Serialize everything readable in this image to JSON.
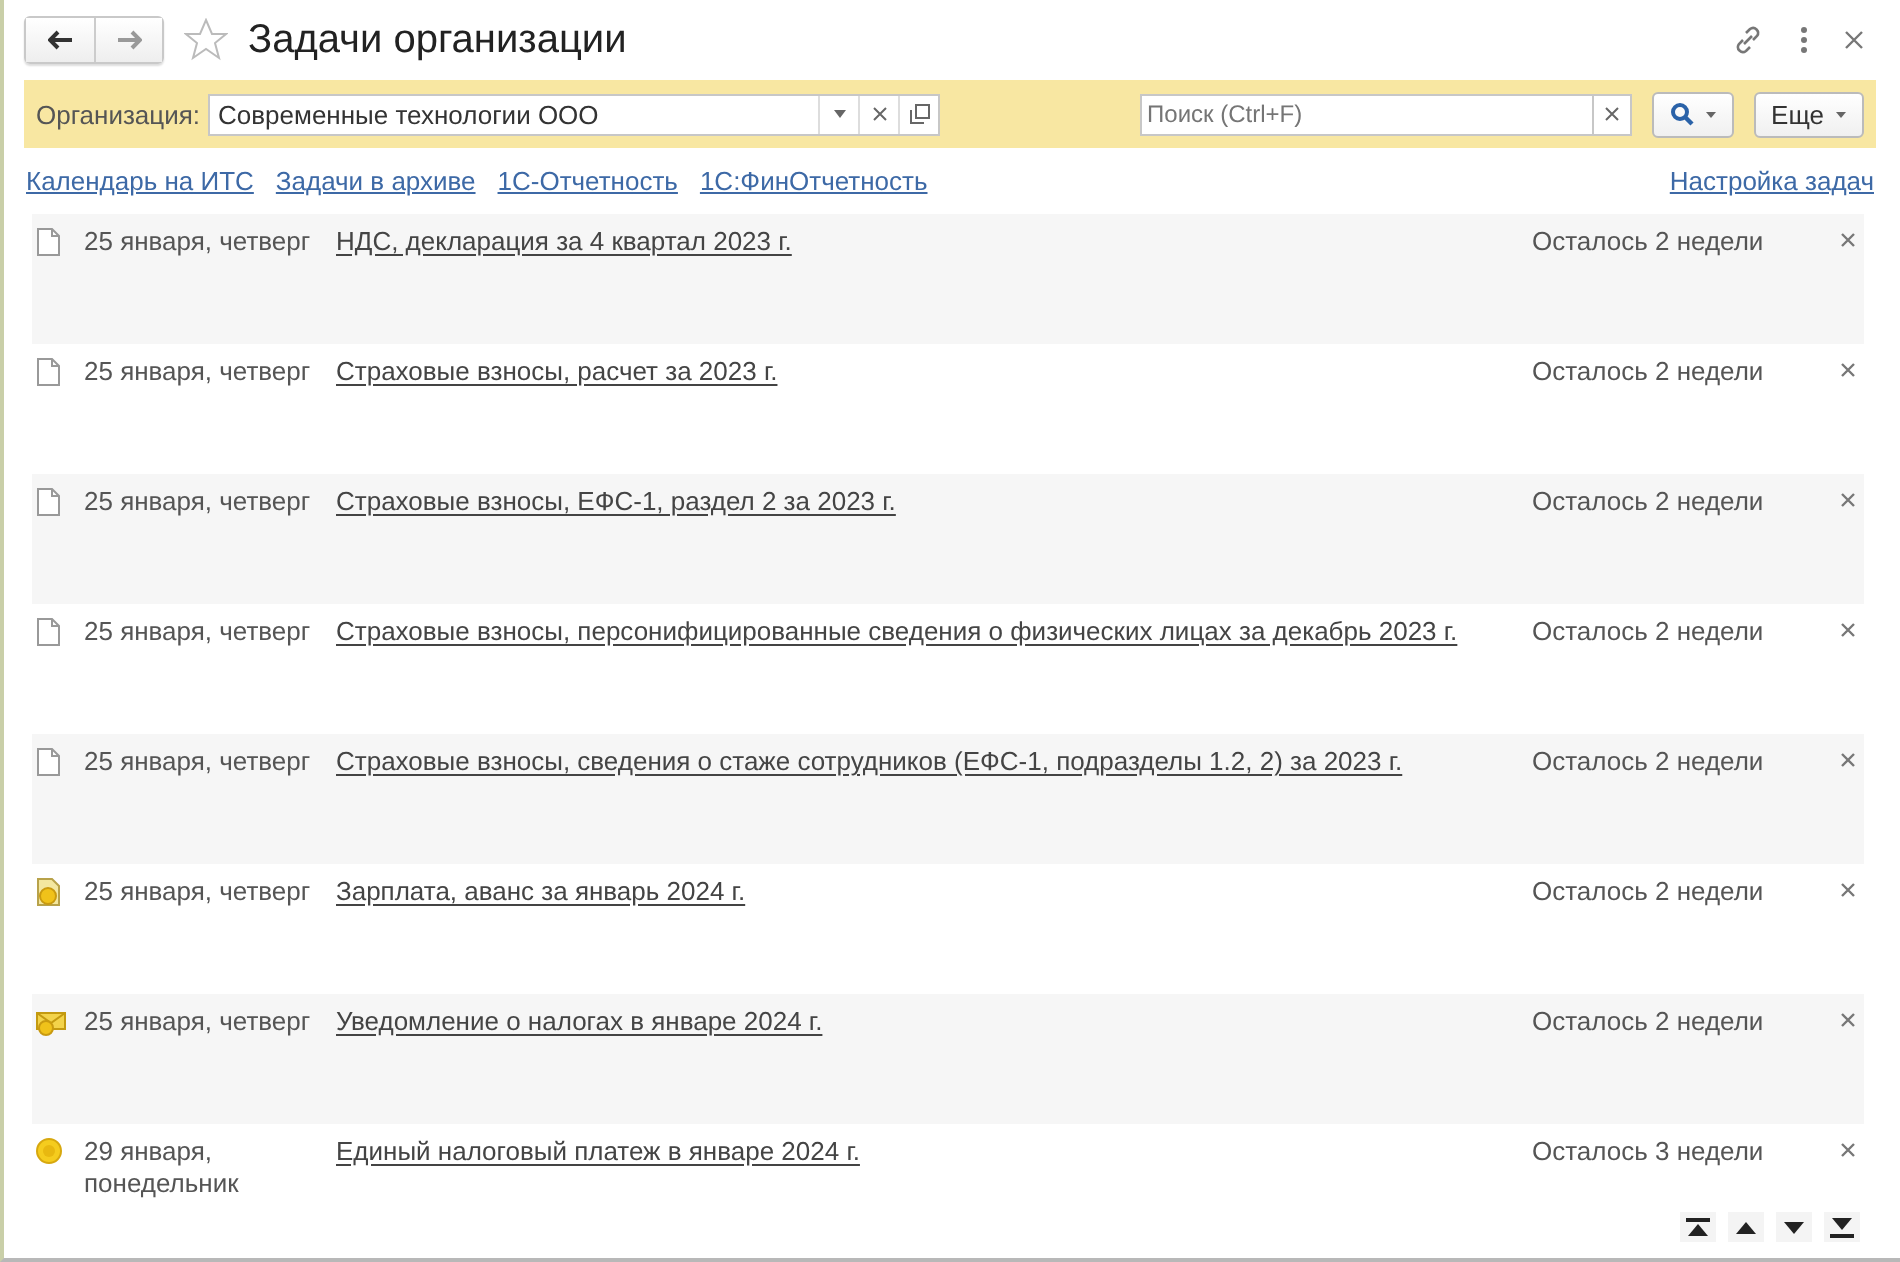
{
  "window": {
    "title": "Задачи организации"
  },
  "filter": {
    "label": "Организация:",
    "value": "Современные технологии ООО",
    "search_placeholder": "Поиск (Ctrl+F)",
    "more_button": "Еще"
  },
  "links": [
    {
      "label": "Календарь на ИТС"
    },
    {
      "label": "Задачи в архиве"
    },
    {
      "label": "1С-Отчетность"
    },
    {
      "label": "1С:ФинОтчетность"
    }
  ],
  "settings_link": "Настройка задач",
  "tasks": [
    {
      "kind": "document",
      "date": "25 января, четверг",
      "title": "НДС, декларация за 4 квартал 2023 г.",
      "remaining": "Осталось 2 недели"
    },
    {
      "kind": "document",
      "date": "25 января, четверг",
      "title": "Страховые взносы, расчет за 2023 г.",
      "remaining": "Осталось 2 недели"
    },
    {
      "kind": "document",
      "date": "25 января, четверг",
      "title": "Страховые взносы, ЕФС-1, раздел 2 за 2023 г.",
      "remaining": "Осталось 2 недели"
    },
    {
      "kind": "document",
      "date": "25 января, четверг",
      "title": "Страховые взносы, персонифицированные сведения о физических лицах за декабрь 2023 г.",
      "remaining": "Осталось 2 недели"
    },
    {
      "kind": "document",
      "date": "25 января, четверг",
      "title": "Страховые взносы, сведения о стаже сотрудников (ЕФС-1, подразделы 1.2, 2) за 2023 г.",
      "remaining": "Осталось 2 недели"
    },
    {
      "kind": "payment-document",
      "date": "25 января, четверг",
      "title": "Зарплата, аванс за январь 2024 г.",
      "remaining": "Осталось 2 недели"
    },
    {
      "kind": "envelope",
      "date": "25 января, четверг",
      "title": "Уведомление о налогах в январе 2024 г.",
      "remaining": "Осталось 2 недели"
    },
    {
      "kind": "coin",
      "date": "29 января, понедельник",
      "title": "Единый налоговый платеж в январе 2024 г.",
      "remaining": "Осталось 3 недели"
    }
  ]
}
